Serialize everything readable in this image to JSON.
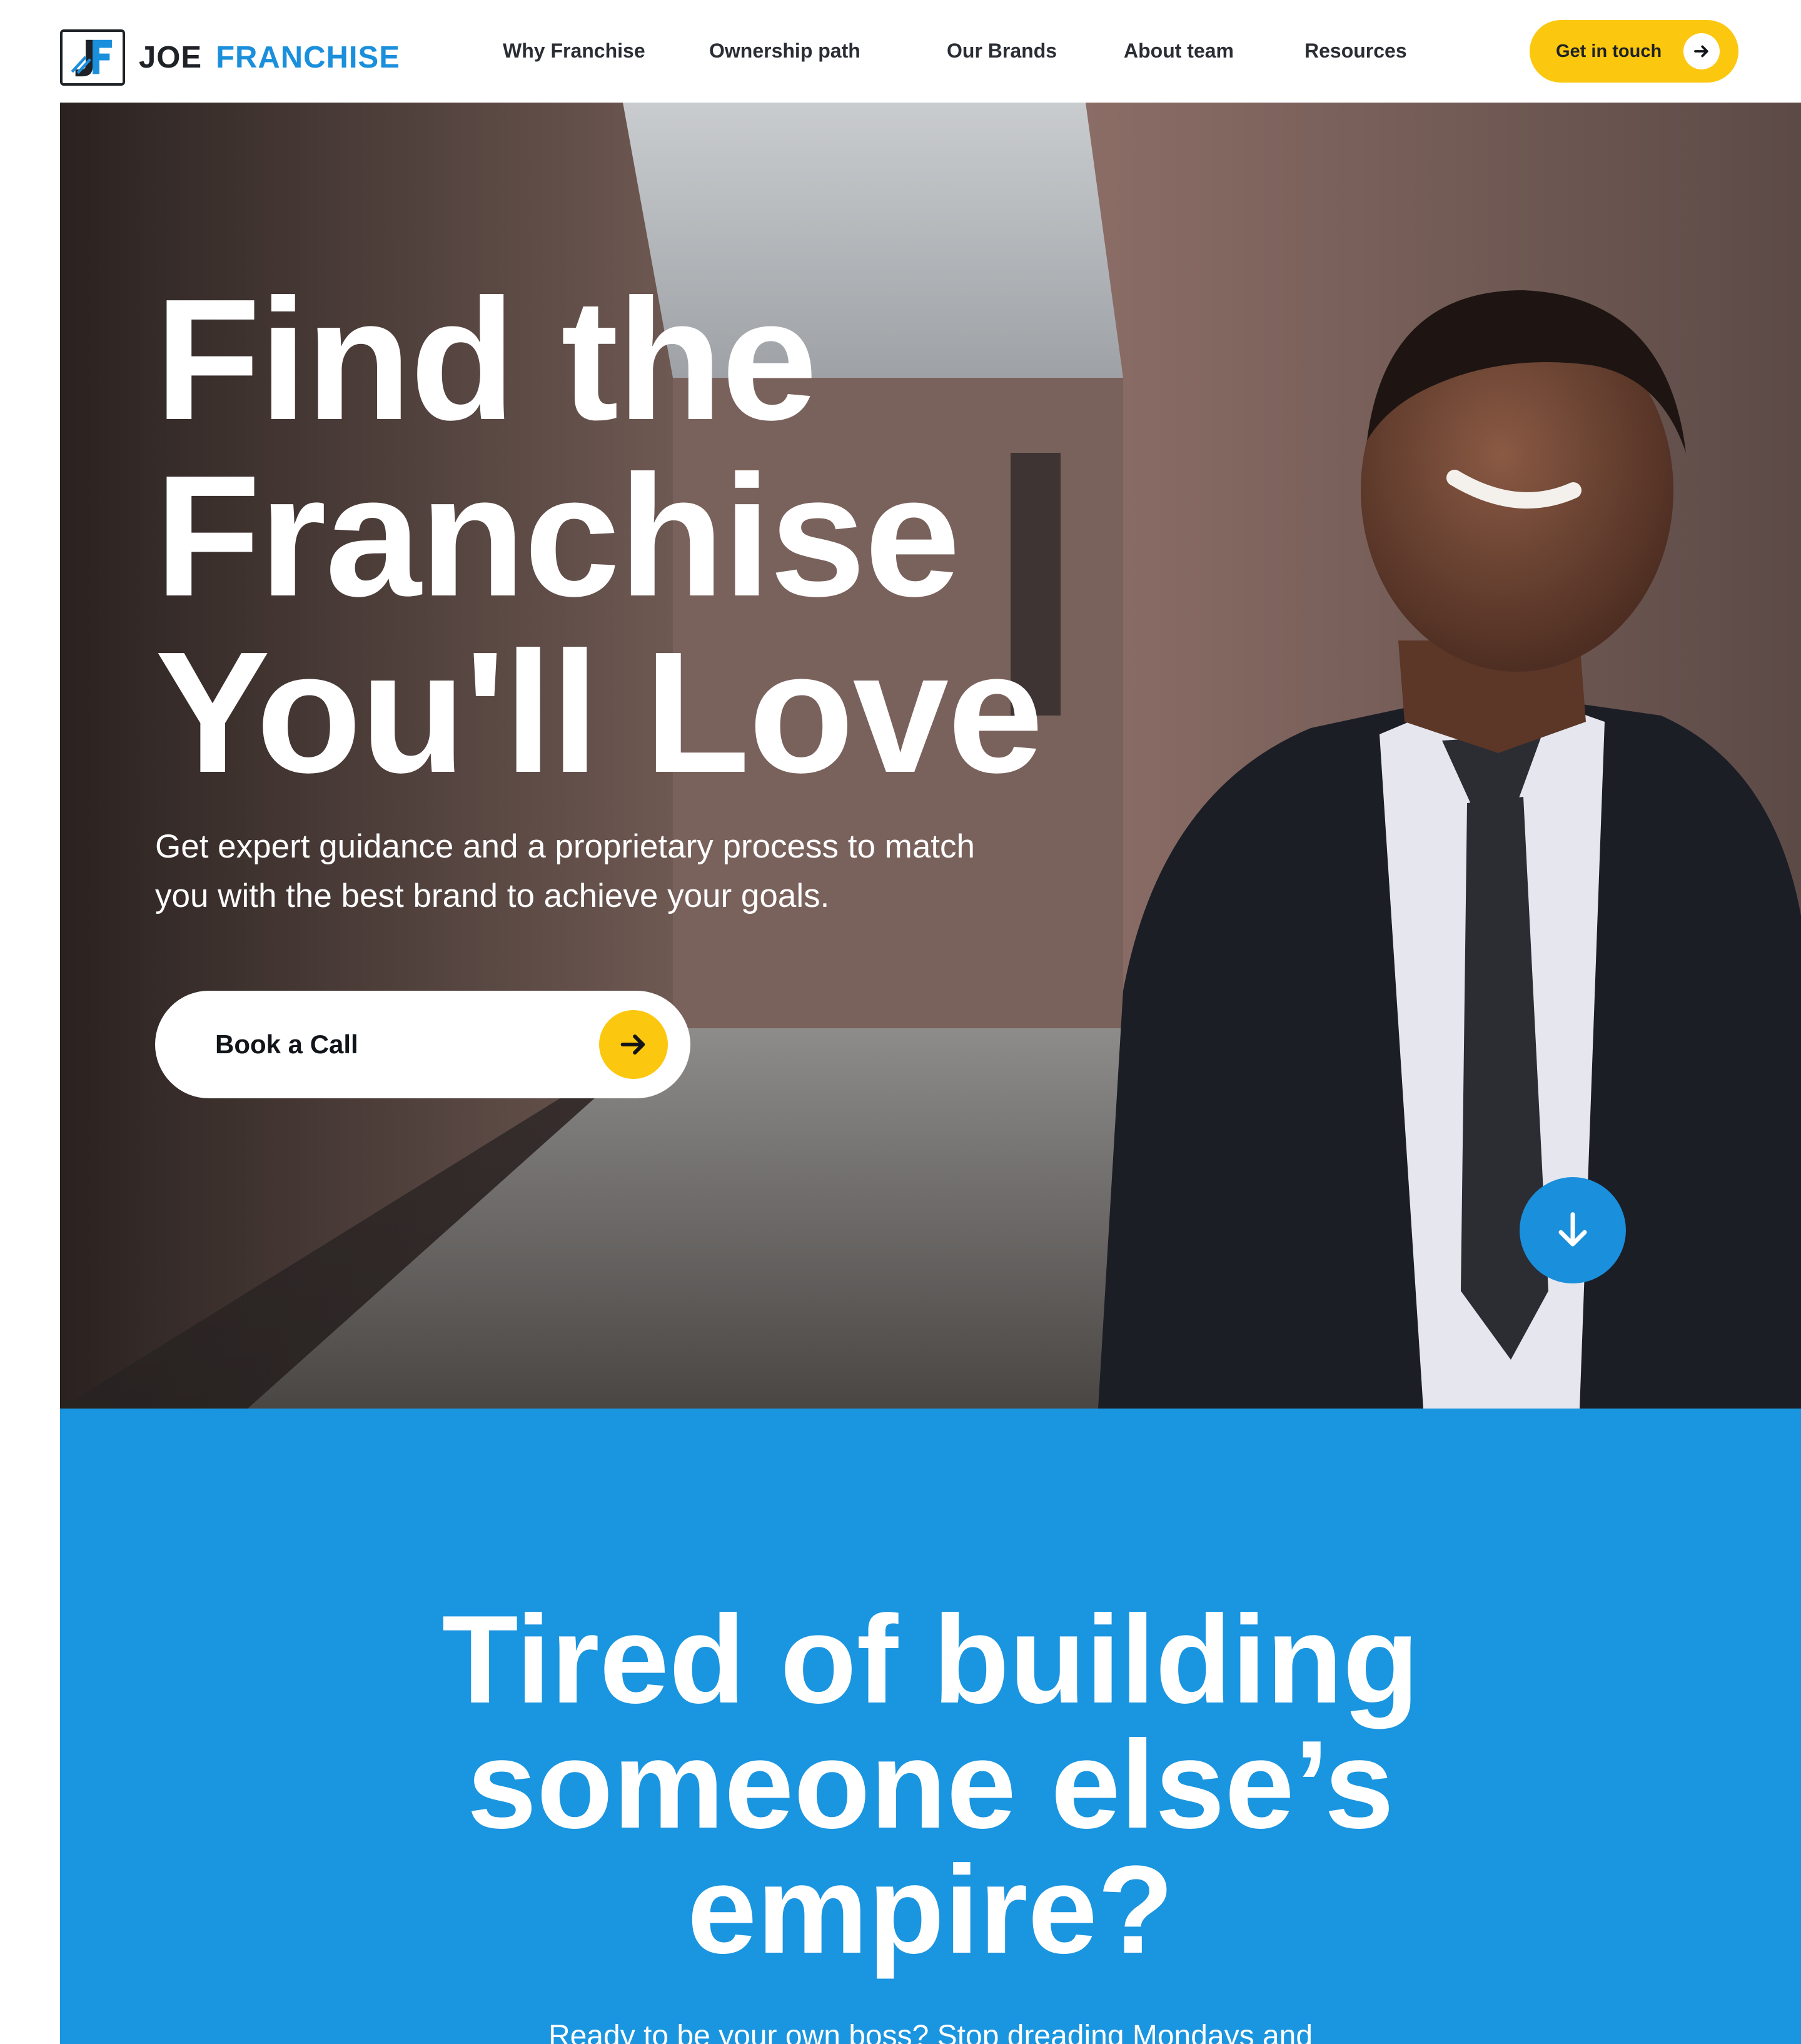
{
  "brand": {
    "name_part1": "JOE",
    "name_part2": "FRANCHISE",
    "logo_icon": "jf-monogram-icon",
    "colors": {
      "dark": "#1e2226",
      "blue": "#1a8fdc"
    }
  },
  "nav": {
    "items": [
      {
        "label": "Why Franchise"
      },
      {
        "label": "Ownership path"
      },
      {
        "label": "Our Brands"
      },
      {
        "label": "About team"
      },
      {
        "label": "Resources"
      }
    ],
    "cta": {
      "label": "Get in touch",
      "icon": "arrow-right-icon",
      "color": "#fcc70f"
    }
  },
  "hero": {
    "title_lines": [
      "Find the",
      "Franchise",
      "You'll Love"
    ],
    "subtitle": "Get expert guidance and a proprietary process to match you with the best brand to achieve your goals.",
    "cta": {
      "label": "Book a Call",
      "icon": "arrow-right-icon",
      "color": "#fcc70f"
    },
    "scroll_icon": "arrow-down-icon",
    "scroll_color": "#1a8fdc"
  },
  "section2": {
    "title_lines": [
      "Tired of building",
      "someone else’s",
      "empire?"
    ],
    "subtitle": "Ready to be your own boss? Stop dreading Mondays and",
    "background": "#1a95e0"
  }
}
